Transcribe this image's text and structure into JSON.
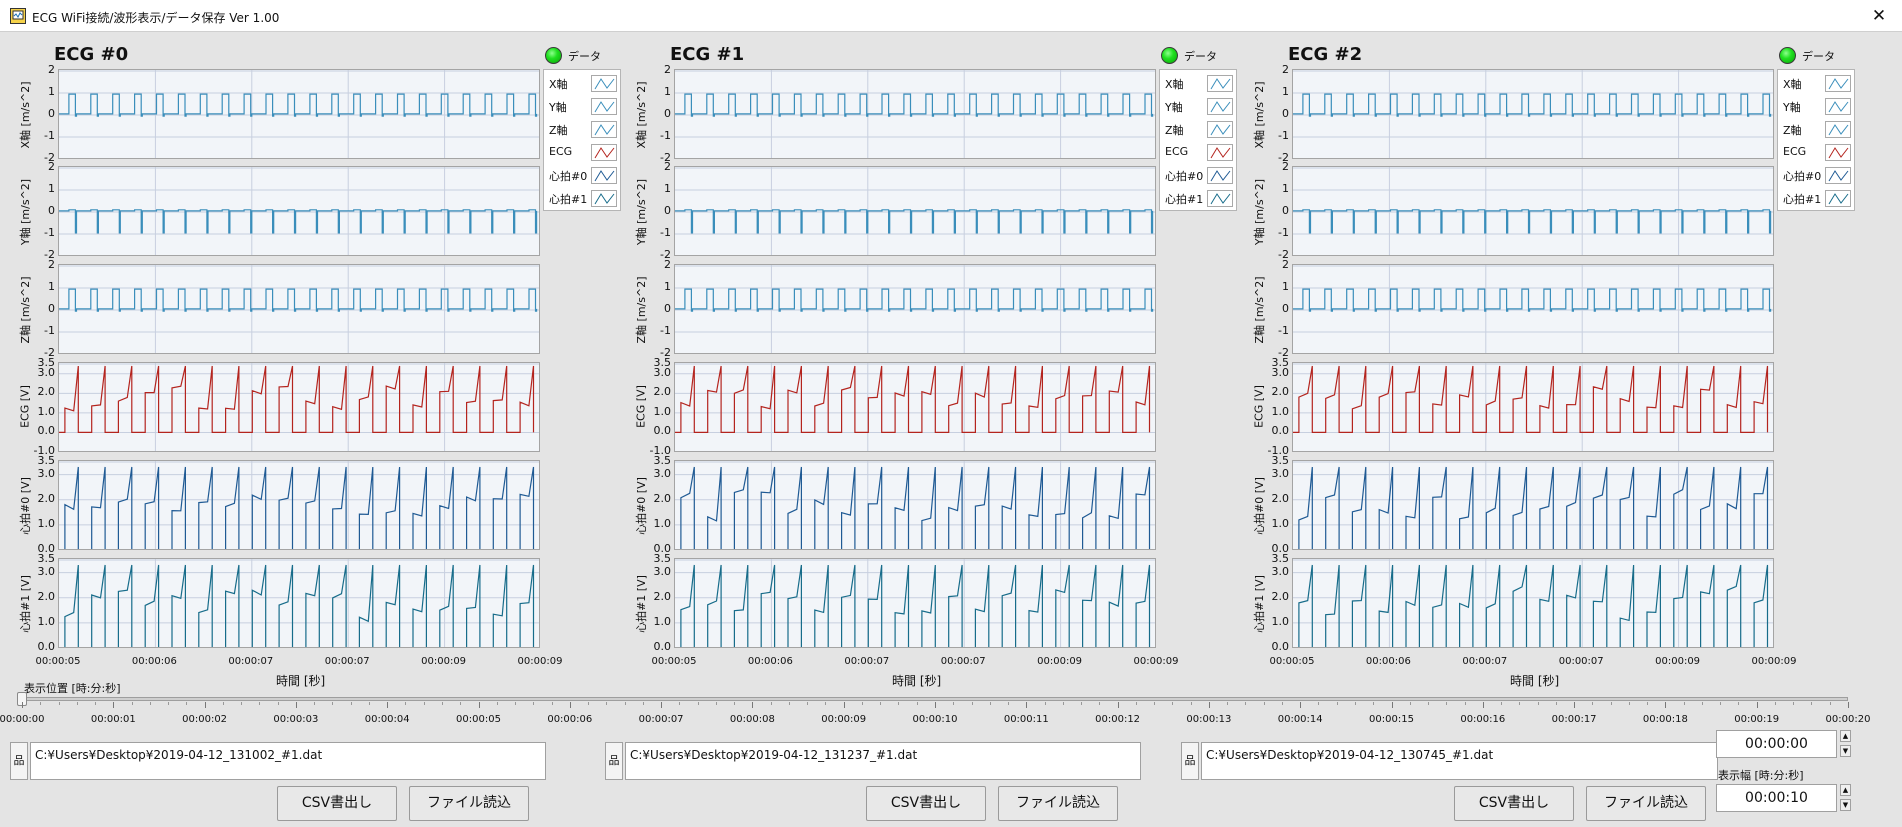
{
  "window": {
    "title": "ECG WiFi接続/波形表示/データ保存 Ver 1.00",
    "close_glyph": "✕"
  },
  "led_label": "データ",
  "legend_items": [
    {
      "label": "X軸",
      "color": "#3a8ebb"
    },
    {
      "label": "Y軸",
      "color": "#3a8ebb"
    },
    {
      "label": "Z軸",
      "color": "#3a8ebb"
    },
    {
      "label": "ECG",
      "color": "#b4241e"
    },
    {
      "label": "心拍#0",
      "color": "#1f5a94"
    },
    {
      "label": "心拍#1",
      "color": "#176c8a"
    }
  ],
  "plot_rows": [
    {
      "ylabel": "X軸 [m/s^2]",
      "yticks": [
        "2",
        "1",
        "0",
        "-1",
        "-2"
      ],
      "ylim": [
        -2,
        2
      ],
      "color": "#3a8ebb",
      "kind": "accel",
      "base": 0.05,
      "high": 0.95,
      "low": -0.05
    },
    {
      "ylabel": "Y軸 [m/s^2]",
      "yticks": [
        "2",
        "1",
        "0",
        "-1",
        "-2"
      ],
      "ylim": [
        -2,
        2
      ],
      "color": "#3a8ebb",
      "kind": "accel",
      "base": 0.05,
      "high": 0.1,
      "low": -0.95
    },
    {
      "ylabel": "Z軸 [m/s^2]",
      "yticks": [
        "2",
        "1",
        "0",
        "-1",
        "-2"
      ],
      "ylim": [
        -2,
        2
      ],
      "color": "#3a8ebb",
      "kind": "accel",
      "base": 0.05,
      "high": 0.95,
      "low": -0.05
    },
    {
      "ylabel": "ECG [V]",
      "yticks": [
        "3.5",
        "3.0",
        "2.0",
        "1.0",
        "0.0",
        "-1.0"
      ],
      "ylim": [
        -1,
        3.5
      ],
      "color": "#b4241e",
      "kind": "ecg",
      "high": 3.4,
      "low": 0.0
    },
    {
      "ylabel": "心拍#0 [V]",
      "yticks": [
        "3.5",
        "3.0",
        "2.0",
        "1.0",
        "0.0"
      ],
      "ylim": [
        0,
        3.5
      ],
      "color": "#1f5a94",
      "kind": "ecg",
      "high": 3.3,
      "low": 0.0
    },
    {
      "ylabel": "心拍#1 [V]",
      "yticks": [
        "3.5",
        "3.0",
        "2.0",
        "1.0",
        "0.0"
      ],
      "ylim": [
        0,
        3.5
      ],
      "color": "#176c8a",
      "kind": "ecg",
      "high": 3.3,
      "low": 0.0
    }
  ],
  "x_ticks": [
    "00:00:05",
    "00:00:06",
    "00:00:07",
    "00:00:07",
    "00:00:09",
    "00:00:09"
  ],
  "x_label": "時間 [秒]",
  "panels": [
    {
      "title": "ECG #0",
      "path": "C:¥Users¥Desktop¥2019-04-12_131002_#1.dat"
    },
    {
      "title": "ECG #1",
      "path": "C:¥Users¥Desktop¥2019-04-12_131237_#1.dat"
    },
    {
      "title": "ECG #2",
      "path": "C:¥Users¥Desktop¥2019-04-12_130745_#1.dat"
    }
  ],
  "path_icon_glyph": "品",
  "buttons": {
    "csv": "CSV書出し",
    "load": "ファイル読込"
  },
  "scrollbar": {
    "label": "表示位置 [時:分:秒]",
    "position": 0.0,
    "ticks": [
      "00:00:00",
      "00:00:01",
      "00:00:02",
      "00:00:03",
      "00:00:04",
      "00:00:05",
      "00:00:06",
      "00:00:07",
      "00:00:08",
      "00:00:09",
      "00:00:10",
      "00:00:11",
      "00:00:12",
      "00:00:13",
      "00:00:14",
      "00:00:15",
      "00:00:16",
      "00:00:17",
      "00:00:18",
      "00:00:19",
      "00:00:20"
    ]
  },
  "display_position": {
    "value": "00:00:00"
  },
  "display_width": {
    "label": "表示幅 [時:分:秒]",
    "value": "00:00:10"
  }
}
